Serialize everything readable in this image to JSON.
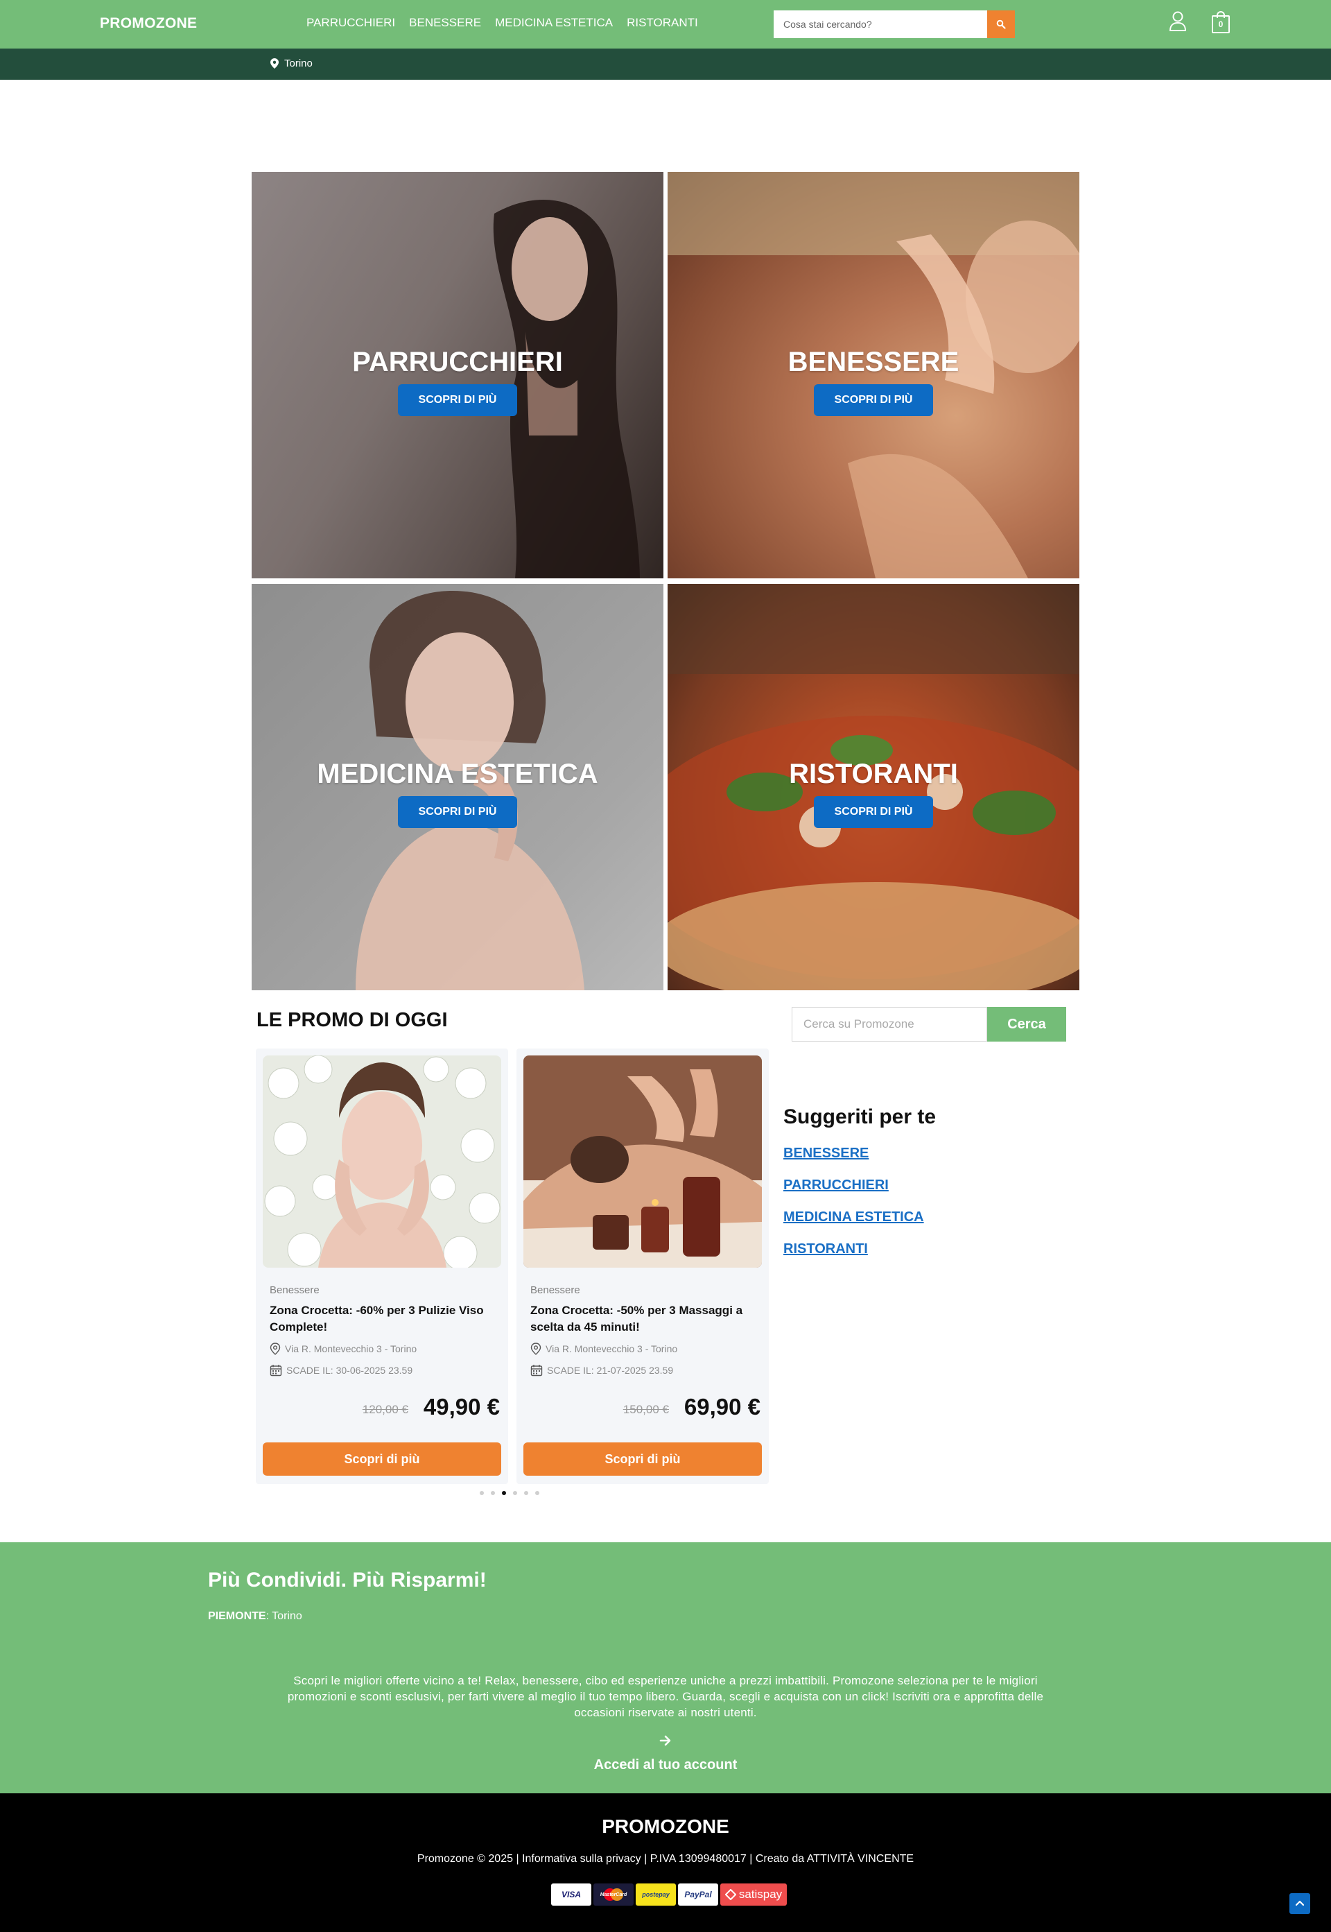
{
  "header": {
    "logo": "PROMOZONE",
    "nav": [
      "PARRUCCHIERI",
      "BENESSERE",
      "MEDICINA ESTETICA",
      "RISTORANTI"
    ],
    "search_placeholder": "Cosa stai cercando?",
    "cart_count": "0",
    "location": "Torino"
  },
  "categories": [
    {
      "title": "PARRUCCHIERI",
      "button": "SCOPRI DI PIÙ"
    },
    {
      "title": "BENESSERE",
      "button": "SCOPRI DI PIÙ"
    },
    {
      "title": "MEDICINA ESTETICA",
      "button": "SCOPRI DI PIÙ"
    },
    {
      "title": "RISTORANTI",
      "button": "SCOPRI DI PIÙ"
    }
  ],
  "promo": {
    "title": "LE PROMO DI OGGI",
    "search_placeholder": "Cerca su Promozone",
    "search_button": "Cerca",
    "cards": [
      {
        "category": "Benessere",
        "title": "Zona Crocetta: -60% per 3 Pulizie Viso Complete!",
        "address": "Via R. Montevecchio 3 - Torino",
        "expiry": "SCADE IL: 30-06-2025 23.59",
        "old_price": "120,00 €",
        "price": "49,90 €",
        "button": "Scopri di più"
      },
      {
        "category": "Benessere",
        "title": "Zona Crocetta: -50% per 3 Massaggi a scelta da 45 minuti!",
        "address": "Via R. Montevecchio 3 - Torino",
        "expiry": "SCADE IL: 21-07-2025 23.59",
        "old_price": "150,00 €",
        "price": "69,90 €",
        "button": "Scopri di più"
      }
    ],
    "dots": 6,
    "active_dot": 3
  },
  "suggested": {
    "title": "Suggeriti per te",
    "links": [
      "BENESSERE",
      "PARRUCCHIERI",
      "MEDICINA ESTETICA",
      "RISTORANTI"
    ]
  },
  "share": {
    "title": "Più Condividi. Più Risparmi!",
    "region": "PIEMONTE",
    "city": ": Torino",
    "text": "Scopri le migliori offerte vicino a te! Relax, benessere, cibo ed esperienze uniche a prezzi imbattibili. Promozone seleziona per te le migliori promozioni e sconti esclusivi, per farti vivere al meglio il tuo tempo libero. Guarda, scegli e acquista con un click! Iscriviti ora e approfitta delle occasioni riservate ai nostri utenti.",
    "login": "Accedi al tuo account"
  },
  "footer": {
    "logo": "PROMOZONE",
    "text": "Promozone © 2025 | Informativa sulla privacy | P.IVA 13099480017 | Creato da ATTIVITÀ VINCENTE",
    "payments": [
      "VISA",
      "MasterCard",
      "postepay",
      "PayPal",
      "satispay"
    ]
  },
  "colors": {
    "green": "#74bd78",
    "dark_green": "#234e3c",
    "orange": "#ef8230",
    "blue": "#0d6bc4"
  }
}
